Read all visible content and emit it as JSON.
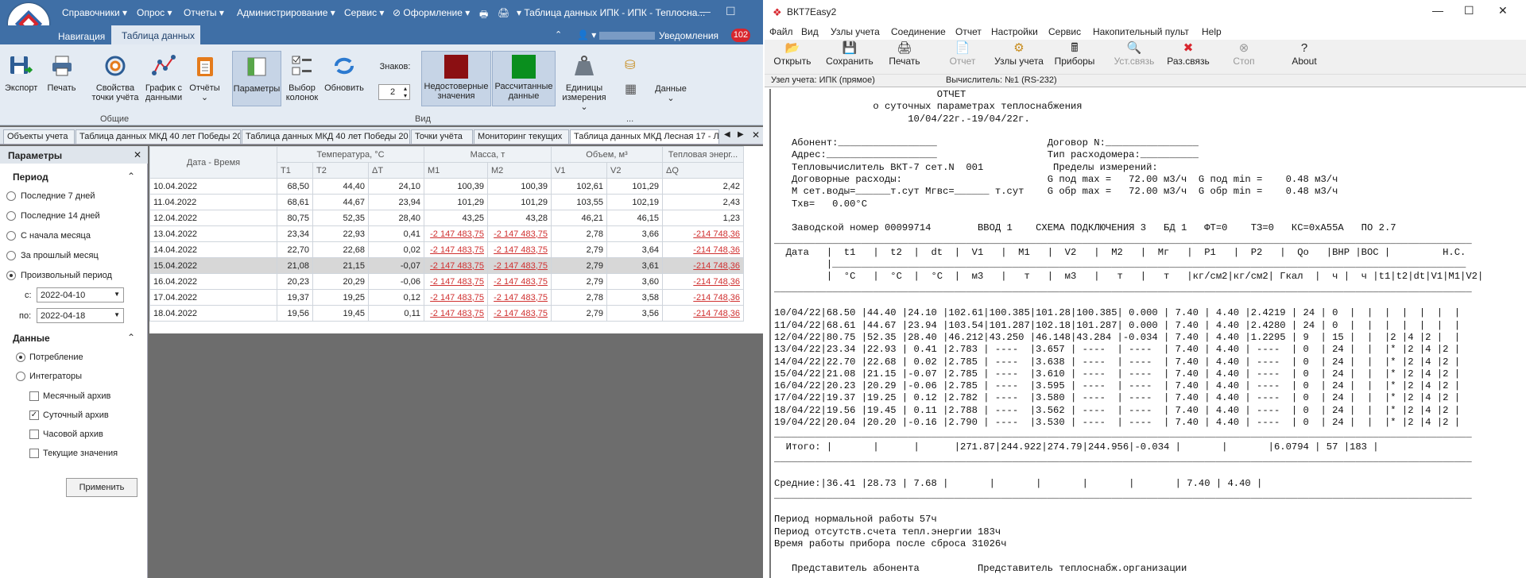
{
  "left_app": {
    "menu": [
      "Справочники",
      "Опрос",
      "Отчеты",
      "Администрирование",
      "Сервис",
      "Оформление"
    ],
    "window_title": "Таблица данных ИПК - ИПК - Теплосна...",
    "tabs": {
      "nav": "Навигация",
      "data": "Таблица данных"
    },
    "user_notif": "Уведомления",
    "notif_count": "102",
    "ribbon": {
      "export": "Экспорт",
      "print": "Печать",
      "props": "Свойства точки учёта",
      "graph": "График с данными",
      "reports": "Отчёты",
      "params": "Параметры",
      "columns": "Выбор колонок",
      "refresh": "Обновить",
      "digits_label": "Знаков:",
      "digits_value": "2",
      "invalid": "Недостоверные значения",
      "calculated": "Рассчитанные данные",
      "units": "Единицы измерения",
      "data": "Данные",
      "group_common": "Общие",
      "group_view": "Вид",
      "group_more": "..."
    },
    "doc_tabs": [
      "Объекты учета",
      "Таблица данных МКД 40 лет Победы 20",
      "Таблица данных МКД 40 лет Победы 20",
      "Точки учёта",
      "Мониторинг текущих",
      "Таблица данных МКД Лесная 17 - Л"
    ],
    "params_panel": {
      "title": "Параметры",
      "period_title": "Период",
      "period_options": [
        "Последние 7 дней",
        "Последние 14 дней",
        "С начала месяца",
        "За прошлый месяц",
        "Произвольный период"
      ],
      "from_label": "с:",
      "from_value": "2022-04-10",
      "to_label": "по:",
      "to_value": "2022-04-18",
      "data_title": "Данные",
      "data_options": [
        "Потребление",
        "Интеграторы"
      ],
      "archives": [
        "Месячный архив",
        "Суточный архив",
        "Часовой архив",
        "Текущие значения"
      ],
      "apply": "Применить"
    },
    "grid": {
      "date_header": "Дата - Время",
      "groups": [
        "Температура, °С",
        "Масса, т",
        "Объем, м³",
        "Тепловая энерг..."
      ],
      "cols": [
        "T1",
        "T2",
        "ΔT",
        "M1",
        "M2",
        "V1",
        "V2",
        "ΔQ"
      ],
      "rows": [
        [
          "10.04.2022",
          "68,50",
          "44,40",
          "24,10",
          "100,39",
          "100,39",
          "102,61",
          "101,29",
          "2,42"
        ],
        [
          "11.04.2022",
          "68,61",
          "44,67",
          "23,94",
          "101,29",
          "101,29",
          "103,55",
          "102,19",
          "2,43"
        ],
        [
          "12.04.2022",
          "80,75",
          "52,35",
          "28,40",
          "43,25",
          "43,28",
          "46,21",
          "46,15",
          "1,23"
        ],
        [
          "13.04.2022",
          "23,34",
          "22,93",
          "0,41",
          "-2 147 483,75",
          "-2 147 483,75",
          "2,78",
          "3,66",
          "-214 748,36"
        ],
        [
          "14.04.2022",
          "22,70",
          "22,68",
          "0,02",
          "-2 147 483,75",
          "-2 147 483,75",
          "2,79",
          "3,64",
          "-214 748,36"
        ],
        [
          "15.04.2022",
          "21,08",
          "21,15",
          "-0,07",
          "-2 147 483,75",
          "-2 147 483,75",
          "2,79",
          "3,61",
          "-214 748,36"
        ],
        [
          "16.04.2022",
          "20,23",
          "20,29",
          "-0,06",
          "-2 147 483,75",
          "-2 147 483,75",
          "2,79",
          "3,60",
          "-214 748,36"
        ],
        [
          "17.04.2022",
          "19,37",
          "19,25",
          "0,12",
          "-2 147 483,75",
          "-2 147 483,75",
          "2,78",
          "3,58",
          "-214 748,36"
        ],
        [
          "18.04.2022",
          "19,56",
          "19,45",
          "0,11",
          "-2 147 483,75",
          "-2 147 483,75",
          "2,79",
          "3,56",
          "-214 748,36"
        ]
      ]
    }
  },
  "right_app": {
    "title": "ВКТ7Easy2",
    "menu": [
      "Файл",
      "Вид",
      "Узлы учета",
      "Соединение",
      "Отчет",
      "Настройки",
      "Сервис",
      "Накопительный пульт",
      "Help"
    ],
    "toolbar": [
      "Открыть",
      "Сохранить",
      "Печать",
      "Отчет",
      "Узлы учета",
      "Приборы",
      "Уст.связь",
      "Раз.связь",
      "Стоп",
      "About"
    ],
    "node_label": "Узел учета: ИПК   (прямое)",
    "calc_label": "Вычислитель: №1 (RS-232)",
    "report_lines": [
      "                            ОТЧЕТ",
      "                 о суточных параметрах теплоснабжения",
      "                       10/04/22г.-19/04/22г.",
      "",
      "   Абонент:_________________                   Договор N:________________",
      "   Адрес:___________________                   Тип расходомера:__________",
      "   Тепловычислитель ВКТ-7 сет.N  001            Пределы измерений:",
      "   Договорные расходы:                         G под max =   72.00 м3/ч  G под min =    0.48 м3/ч",
      "   М сет.воды=______т.сут Мгвс=______ т.сут    G обр max =   72.00 м3/ч  G обр min =    0.48 м3/ч",
      "   Тхв=   0.00°С",
      "",
      "   Заводской номер 00099714        ВВОД 1    СХЕМА ПОДКЛЮЧЕНИЯ 3   БД 1   ФТ=0    ТЗ=0   КС=0хА55А   ПО 2.7",
      "________________________________________________________________________________________________________________________",
      "  Дата   |  t1   |  t2  |  dt  |  V1   |  M1   |  V2   |  M2   |  Мг   |  P1   |  P2   |  Qо   |ВНР |ВОС |         Н.С.",
      "         |_____________________________________________________________________________________________________________",
      "         |  °С   |  °С  |  °С  |  м3   |   т   |  м3   |   т   |   т   |кг/см2|кг/см2| Гкал  |  ч |  ч |t1|t2|dt|V1|M1|V2|",
      "________________________________________________________________________________________________________________________",
      "",
      "10/04/22|68.50 |44.40 |24.10 |102.61|100.385|101.28|100.385| 0.000 | 7.40 | 4.40 |2.4219 | 24 | 0  |  |  |  |  |  |  |",
      "11/04/22|68.61 |44.67 |23.94 |103.54|101.287|102.18|101.287| 0.000 | 7.40 | 4.40 |2.4280 | 24 | 0  |  |  |  |  |  |  |",
      "12/04/22|80.75 |52.35 |28.40 |46.212|43.250 |46.148|43.284 |-0.034 | 7.40 | 4.40 |1.2295 | 9  | 15 |  |  |2 |4 |2 |  |",
      "13/04/22|23.34 |22.93 | 0.41 |2.783 | ----  |3.657 | ----  | ----  | 7.40 | 4.40 | ----  | 0  | 24 |  |  |* |2 |4 |2 |",
      "14/04/22|22.70 |22.68 | 0.02 |2.785 | ----  |3.638 | ----  | ----  | 7.40 | 4.40 | ----  | 0  | 24 |  |  |* |2 |4 |2 |",
      "15/04/22|21.08 |21.15 |-0.07 |2.785 | ----  |3.610 | ----  | ----  | 7.40 | 4.40 | ----  | 0  | 24 |  |  |* |2 |4 |2 |",
      "16/04/22|20.23 |20.29 |-0.06 |2.785 | ----  |3.595 | ----  | ----  | 7.40 | 4.40 | ----  | 0  | 24 |  |  |* |2 |4 |2 |",
      "17/04/22|19.37 |19.25 | 0.12 |2.782 | ----  |3.580 | ----  | ----  | 7.40 | 4.40 | ----  | 0  | 24 |  |  |* |2 |4 |2 |",
      "18/04/22|19.56 |19.45 | 0.11 |2.788 | ----  |3.562 | ----  | ----  | 7.40 | 4.40 | ----  | 0  | 24 |  |  |* |2 |4 |2 |",
      "19/04/22|20.04 |20.20 |-0.16 |2.790 | ----  |3.530 | ----  | ----  | 7.40 | 4.40 | ----  | 0  | 24 |  |  |* |2 |4 |2 |",
      "________________________________________________________________________________________________________________________",
      "  Итого: |       |      |      |271.87|244.922|274.79|244.956|-0.034 |       |       |6.0794 | 57 |183 |",
      "________________________________________________________________________________________________________________________",
      "",
      "Средние:|36.41 |28.73 | 7.68 |       |       |       |       |       | 7.40 | 4.40 |",
      "________________________________________________________________________________________________________________________",
      "",
      "Период нормальной работы 57ч",
      "Период отсутств.счета тепл.энергии 183ч",
      "Время работы прибора после сброса 31026ч",
      "",
      "   Представитель абонента          Представитель теплоснабж.организации"
    ]
  },
  "colors": {
    "brand_blue": "#3f6fa6",
    "invalid_red": "#8b0f12",
    "calc_green": "#0a8f1e",
    "notif_red": "#d8262e"
  }
}
